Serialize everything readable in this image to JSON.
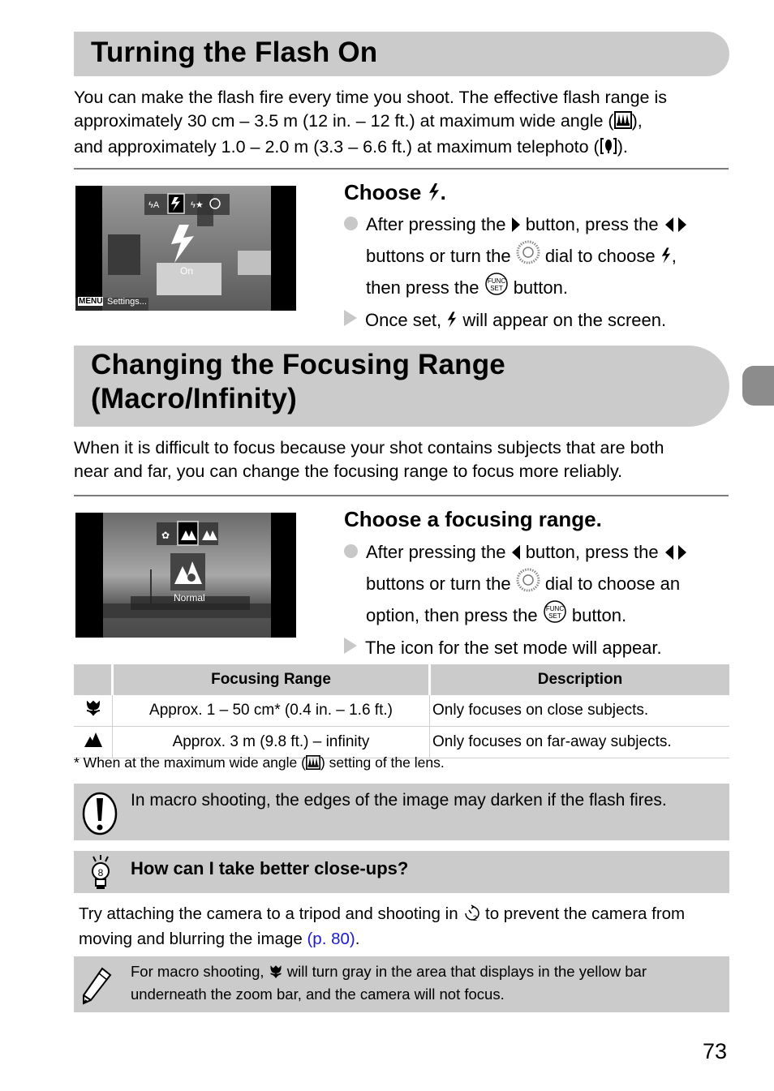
{
  "section1": {
    "title": "Turning the Flash On",
    "intro_lines": [
      "You can make the flash fire every time you shoot. The effective flash range is",
      "approximately 30 cm – 3.5 m (12 in. – 12 ft.) at maximum wide angle (",
      "and approximately 1.0 – 2.0 m (3.3 – 6.6 ft.) at maximum telephoto ("
    ],
    "intro_line2_tail": "),",
    "intro_line3_tail": ").",
    "screen": {
      "mode_label": "On",
      "menu_label": "MENU",
      "settings_label": "Settings..."
    },
    "step": {
      "heading": "Choose",
      "heading_tail": ".",
      "b1_l1a": "After pressing the",
      "b1_l1b": "button, press the",
      "b1_l2a": "buttons or turn the",
      "b1_l2b": "dial to choose",
      "b1_l2c": ",",
      "b1_l3a": "then press the",
      "b1_l3b": "button.",
      "r1a": "Once set,",
      "r1b": "will appear on the screen."
    }
  },
  "section2": {
    "title_l1": "Changing the Focusing Range",
    "title_l2": "(Macro/Infinity)",
    "intro_lines": [
      "When it is difficult to focus because your shot contains subjects that are both",
      "near and far, you can change the focusing range to focus more reliably."
    ],
    "screen": {
      "mode_label": "Normal"
    },
    "step": {
      "heading": "Choose a focusing range.",
      "b1_l1a": "After pressing the",
      "b1_l1b": "button, press the",
      "b1_l2a": "buttons or turn the",
      "b1_l2b": "dial to choose an",
      "b1_l3a": "option, then press the",
      "b1_l3b": "button.",
      "r1": "The icon for the set mode will appear."
    }
  },
  "table": {
    "headers": [
      "",
      "Focusing Range",
      "Description"
    ],
    "rows": [
      {
        "icon": "macro-icon",
        "range": "Approx. 1 – 50 cm* (0.4 in. – 1.6 ft.)",
        "description": "Only focuses on close subjects."
      },
      {
        "icon": "infinity-icon",
        "range": "Approx. 3 m (9.8 ft.) – infinity",
        "description": "Only focuses on far-away subjects."
      }
    ],
    "footnote_a": "* When at the maximum wide angle (",
    "footnote_b": ") setting of the lens."
  },
  "caution": {
    "text": "In macro shooting, the edges of the image may darken if the flash fires."
  },
  "tip": {
    "heading": "How can I take better close-ups?",
    "line1a": "Try attaching the camera to a tripod and shooting in",
    "line1b": "to prevent the camera from",
    "line2a": "moving and blurring the image",
    "link": "(p. 80)",
    "line2b": "."
  },
  "memo": {
    "line1a": "For macro shooting,",
    "line1b": "will turn gray in the area that displays in the yellow bar",
    "line2": "underneath the zoom bar, and the camera will not focus."
  },
  "page_number": "73"
}
